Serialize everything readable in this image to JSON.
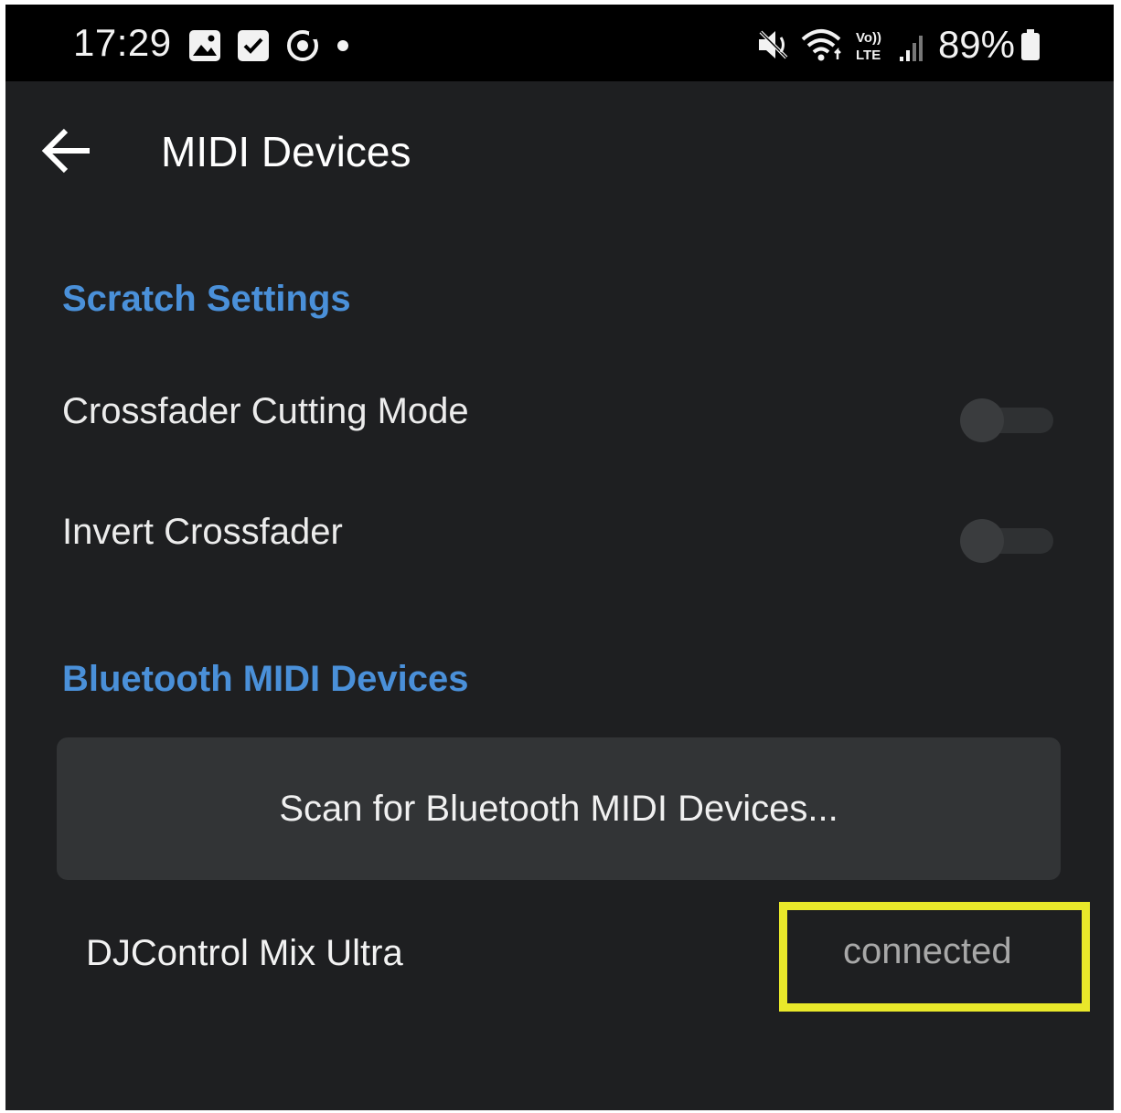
{
  "status_bar": {
    "time": "17:29",
    "left_icons": [
      "gallery-icon",
      "checkbox-icon",
      "circle-app-icon",
      "dot-icon"
    ],
    "right_icons": [
      "mute-icon",
      "wifi-icon",
      "volte-icon",
      "signal-icon",
      "battery-icon"
    ],
    "volte_top": "Vo))",
    "volte_bottom": "LTE",
    "battery_percent": "89%"
  },
  "app_bar": {
    "title": "MIDI Devices"
  },
  "scratch_section": {
    "header": "Scratch Settings",
    "items": [
      {
        "label": "Crossfader Cutting Mode",
        "enabled": false
      },
      {
        "label": "Invert Crossfader",
        "enabled": false
      }
    ]
  },
  "bluetooth_section": {
    "header": "Bluetooth MIDI Devices",
    "scan_button_label": "Scan for Bluetooth MIDI Devices...",
    "devices": [
      {
        "name": "DJControl Mix Ultra",
        "status": "connected"
      }
    ]
  },
  "colors": {
    "accent": "#4a90d9",
    "background": "#1e1f21",
    "highlight": "#e9e82a"
  }
}
